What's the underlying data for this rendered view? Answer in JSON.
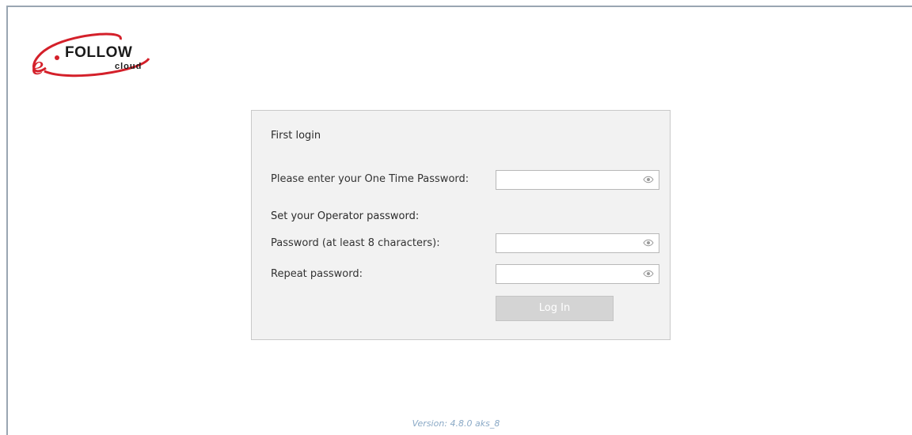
{
  "logo": {
    "brand_prefix": "e",
    "brand": "FOLLOW",
    "sub": "cloud"
  },
  "login": {
    "title": "First login",
    "otp_label": "Please enter your One Time Password:",
    "otp_value": "",
    "section_label": "Set your Operator password:",
    "password_label": "Password (at least 8 characters):",
    "password_value": "",
    "repeat_label": "Repeat password:",
    "repeat_value": "",
    "login_button": "Log In"
  },
  "footer": {
    "version": "Version: 4.8.0 aks_8"
  },
  "colors": {
    "brand_red": "#d4202a",
    "panel_bg": "#f2f2f2",
    "button_disabled": "#d4d4d4",
    "version_text": "#8aa9c6"
  }
}
